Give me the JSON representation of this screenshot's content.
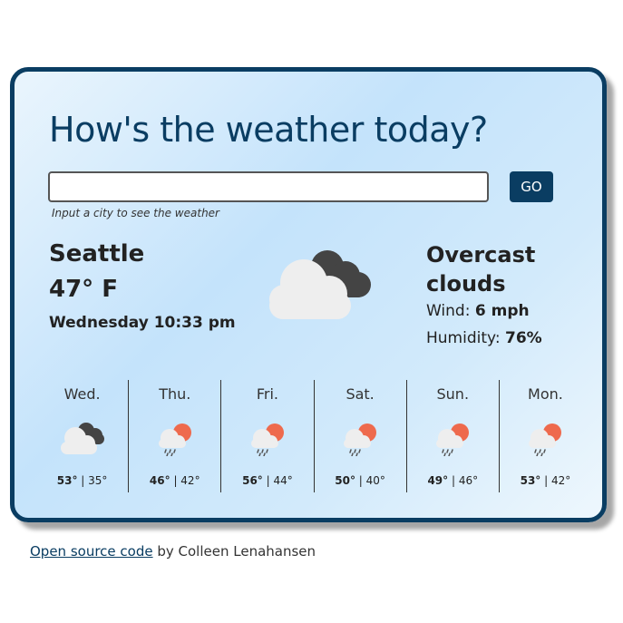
{
  "title": "How's the weather today?",
  "search": {
    "value": "",
    "placeholder": "",
    "button_label": "GO",
    "hint": "Input a city to see the weather"
  },
  "current": {
    "city": "Seattle",
    "temperature": "47° F",
    "datetime": "Wednesday 10:33 pm",
    "icon": "overcast-clouds-icon",
    "description": "Overcast clouds",
    "wind_label": "Wind:",
    "wind_value": "6 mph",
    "humidity_label": "Humidity:",
    "humidity_value": "76%"
  },
  "forecast": [
    {
      "day": "Wed.",
      "icon": "overcast-clouds-icon",
      "high": "53°",
      "low": "35°"
    },
    {
      "day": "Thu.",
      "icon": "sun-rain-icon",
      "high": "46°",
      "low": "42°"
    },
    {
      "day": "Fri.",
      "icon": "sun-rain-icon",
      "high": "56°",
      "low": "44°"
    },
    {
      "day": "Sat.",
      "icon": "sun-rain-icon",
      "high": "50°",
      "low": "40°"
    },
    {
      "day": "Sun.",
      "icon": "sun-rain-icon",
      "high": "49°",
      "low": "46°"
    },
    {
      "day": "Mon.",
      "icon": "sun-rain-icon",
      "high": "53°",
      "low": "42°"
    }
  ],
  "footer": {
    "link_text": "Open source code",
    "byline": " by Colleen Lenahansen"
  },
  "colors": {
    "primary": "#0a3d62",
    "sun": "#ee6a4d",
    "dark_cloud": "#444444",
    "light_cloud": "#eeeeee"
  }
}
